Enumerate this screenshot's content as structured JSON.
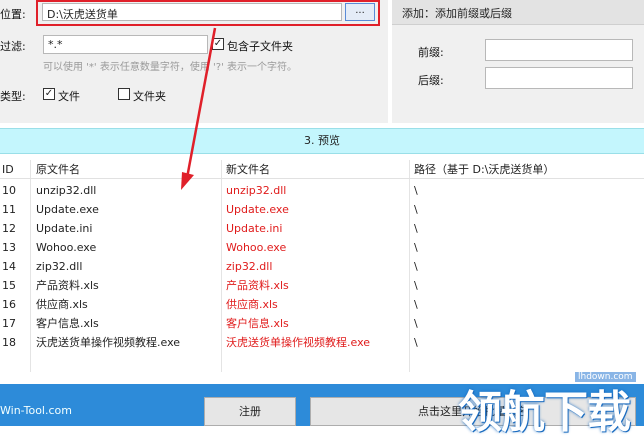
{
  "settings": {
    "location_label": "位置:",
    "location_value": "D:\\沃虎送货单",
    "browse_label": "...",
    "filter_label": "过滤:",
    "filter_value": "*.*",
    "include_subfolders_label": "包含子文件夹",
    "include_subfolders_checked": true,
    "hint": "可以使用 '*' 表示任意数量字符，使用 '?' 表示一个字符。",
    "type_label": "类型:",
    "type_file_label": "文件",
    "type_file_checked": true,
    "type_folder_label": "文件夹",
    "type_folder_checked": false
  },
  "add_panel": {
    "header": "添加：添加前缀或后缀",
    "prefix_label": "前缀:",
    "prefix_value": "",
    "suffix_label": "后缀:",
    "suffix_value": ""
  },
  "preview": {
    "title": "3. 预览"
  },
  "table": {
    "columns": [
      "ID",
      "原文件名",
      "新文件名",
      "路径（基于 D:\\沃虎送货单）"
    ],
    "rows": [
      {
        "id": "10",
        "original": "unzip32.dll",
        "new": "unzip32.dll",
        "path": "\\"
      },
      {
        "id": "11",
        "original": "Update.exe",
        "new": "Update.exe",
        "path": "\\"
      },
      {
        "id": "12",
        "original": "Update.ini",
        "new": "Update.ini",
        "path": "\\"
      },
      {
        "id": "13",
        "original": "Wohoo.exe",
        "new": "Wohoo.exe",
        "path": "\\"
      },
      {
        "id": "14",
        "original": "zip32.dll",
        "new": "zip32.dll",
        "path": "\\"
      },
      {
        "id": "15",
        "original": "产品资料.xls",
        "new": "产品资料.xls",
        "path": "\\"
      },
      {
        "id": "16",
        "original": "供应商.xls",
        "new": "供应商.xls",
        "path": "\\"
      },
      {
        "id": "17",
        "original": "客户信息.xls",
        "new": "客户信息.xls",
        "path": "\\"
      },
      {
        "id": "18",
        "original": "沃虎送货单操作视频教程.exe",
        "new": "沃虎送货单操作视频教程.exe",
        "path": "\\"
      }
    ]
  },
  "footer": {
    "brand": "Win-Tool.com",
    "register_label": "注册",
    "start_label": "点击这里开始批量改名"
  },
  "watermark": {
    "text": "领航下载",
    "url": "lhdown.com"
  },
  "colors": {
    "highlight_border": "#e0202a",
    "new_name_text": "#e01b1b",
    "preview_bar": "#c4f6fd",
    "bottom_bar": "#2d8bd9"
  }
}
